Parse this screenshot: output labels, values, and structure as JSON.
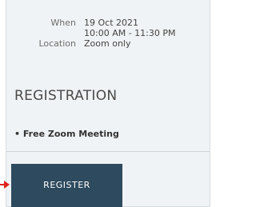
{
  "event": {
    "when_label": "When",
    "date": "19 Oct 2021",
    "time": "10:00 AM - 11:30 PM",
    "location_label": "Location",
    "location": "Zoom only"
  },
  "registration": {
    "title": "REGISTRATION",
    "items": [
      {
        "label": "Free Zoom Meeting"
      }
    ],
    "register_button_label": "REGISTER"
  },
  "colors": {
    "panel_background": "#f0f3f5",
    "button_background": "#2e4a5e",
    "arrow": "#e02020"
  },
  "icons": {
    "pointer_arrow": "red-arrow-icon"
  }
}
